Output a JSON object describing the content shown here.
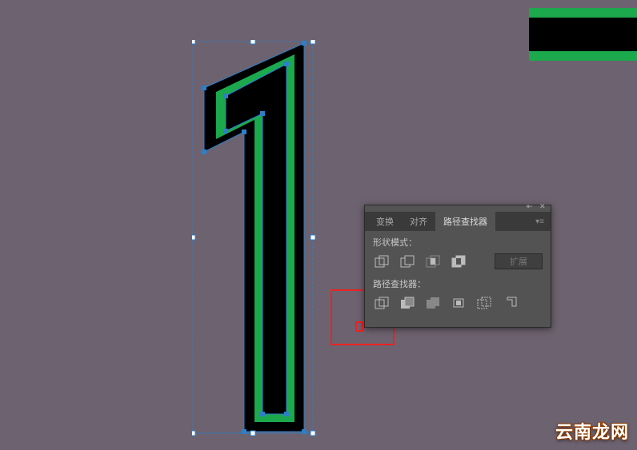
{
  "panel": {
    "tabs": {
      "transform": "变换",
      "align": "对齐",
      "pathfinder": "路径查找器"
    },
    "shape_modes_label": "形状模式：",
    "pathfinders_label": "路径查找器：",
    "expand_label": "扩展",
    "icons": {
      "unite": "unite-icon",
      "minus_front": "minus-front-icon",
      "intersect": "intersect-icon",
      "exclude": "exclude-icon",
      "divide": "divide-icon",
      "trim": "trim-icon",
      "merge": "merge-icon",
      "crop": "crop-icon",
      "outline": "outline-icon",
      "minus_back": "minus-back-icon"
    }
  },
  "watermark": "云南龙网",
  "colors": {
    "canvas_bg": "#6d626f",
    "panel_bg": "#535353",
    "accent_green": "#1ca84d",
    "black": "#000000",
    "selection": "#2d7fc8",
    "highlight": "#ee2222"
  }
}
